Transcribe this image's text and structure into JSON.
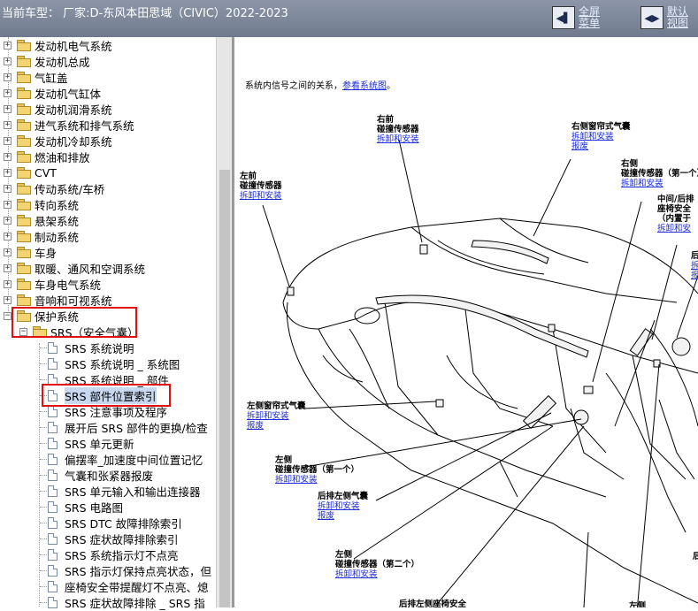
{
  "header": {
    "current_model": "当前车型：  厂家:D-东风本田思域（CIVIC）2022-2023",
    "fullscreen_menu": "全屏菜单",
    "default_view": "默认视图"
  },
  "tree": {
    "top_items": [
      "发动机电气系统",
      "发动机总成",
      "气缸盖",
      "发动机气缸体",
      "发动机润滑系统",
      "进气系统和排气系统",
      "发动机冷却系统",
      "燃油和排放",
      "CVT",
      "传动系统/车桥",
      "转向系统",
      "悬架系统",
      "制动系统",
      "车身",
      "取暖、通风和空调系统",
      "车身电气系统",
      "音响和可视系统",
      "保护系统"
    ],
    "sub_folder": "SRS（安全气囊）",
    "docs": [
      "SRS 系统说明",
      "SRS 系统说明 _ 系统图",
      "SRS 系统说明 _ 部件",
      "SRS 部件位置索引",
      "SRS 注意事项及程序",
      "展开后 SRS 部件的更换/检查",
      "SRS 单元更新",
      "偏摆率_加速度中间位置记忆",
      "气囊和张紧器报废",
      "SRS 单元输入和输出连接器",
      "SRS 电路图",
      "SRS DTC 故障排除索引",
      "SRS 症状故障排除索引",
      "SRS 系统指示灯不点亮",
      "SRS 指示灯保持点亮状态，但",
      "座椅安全带提醒灯不点亮、熄",
      "SRS 症状故障排除 _ SRS 指"
    ]
  },
  "content": {
    "intro_text": "系统内信号之间的关系，",
    "intro_link": "参看系统图",
    "intro_end": "。",
    "labels": {
      "rf_sensor_pos": "右前",
      "rf_sensor_name": "碰撞传感器",
      "rf_sensor_link": "拆卸和安装",
      "r_curtain_name": "右侧窗帘式气囊",
      "r_curtain_link1": "拆卸和安装",
      "r_curtain_link2": "报废",
      "r_side_pos": "右侧",
      "r_side_name": "碰撞传感器（第一个）",
      "r_side_link": "拆卸和安装",
      "lf_sensor_pos": "左前",
      "lf_sensor_name": "碰撞传感器",
      "lf_sensor_link": "拆卸和安装",
      "mid_rear_line1": "中间/后排",
      "mid_rear_line2": "座椅安全",
      "mid_rear_line3": "（内置于",
      "mid_rear_link": "拆卸和安",
      "far_right_pos": "后",
      "far_right_link1": "拆",
      "far_right_link2": "报",
      "l_curtain_name": "左侧窗帘式气囊",
      "l_curtain_link1": "拆卸和安装",
      "l_curtain_link2": "报废",
      "l_side1_pos": "左侧",
      "l_side1_name": "碰撞传感器（第一个）",
      "l_side1_link": "拆卸和安装",
      "rl_side_name": "后排左侧气囊",
      "rl_side_link1": "拆卸和安装",
      "rl_side_link2": "报废",
      "l_side2_pos": "左侧",
      "l_side2_name": "碰撞传感器（第二个）",
      "l_side2_link": "拆卸和安装",
      "bottom_left": "后排左侧座椅安全",
      "bottom_right": "左侧",
      "far_right_bottom": "后"
    }
  }
}
